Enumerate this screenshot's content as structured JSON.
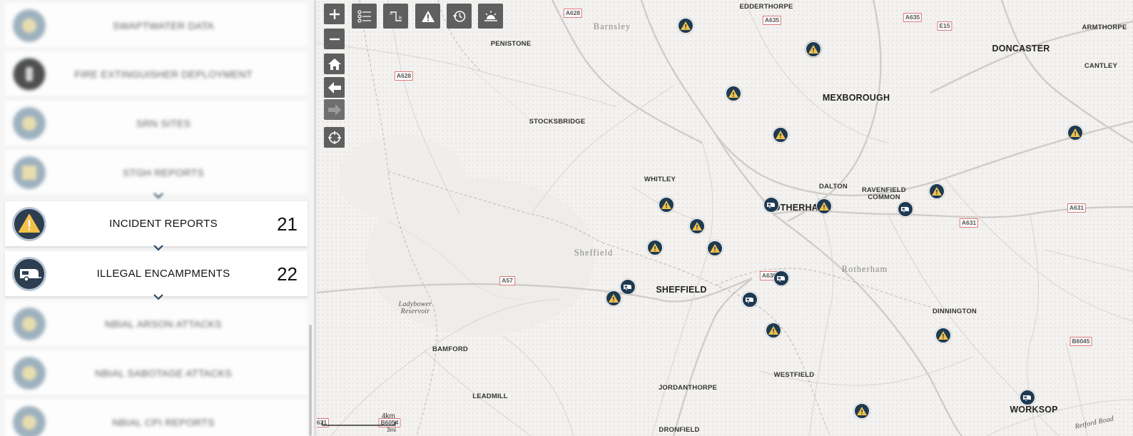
{
  "sidebar": {
    "layers": [
      {
        "label": "SWAPTWATER DATA",
        "blurred": true
      },
      {
        "label": "FIRE EXTINGUISHER DEPLOYMENT",
        "blurred": true
      },
      {
        "label": "SRN SITES",
        "blurred": true
      },
      {
        "label": "STGH REPORTS",
        "blurred": true
      },
      {
        "label": "INCIDENT REPORTS",
        "count": "21",
        "icon": "warning-icon",
        "blurred": false
      },
      {
        "label": "ILLEGAL ENCAMPMENTS",
        "count": "22",
        "icon": "caravan-icon",
        "blurred": false
      },
      {
        "label": "NBIAL ARSON ATTACKS",
        "blurred": true
      },
      {
        "label": "NBIAL SABOTAGE ATTACKS",
        "blurred": true
      },
      {
        "label": "NBIAL CPI REPORTS",
        "blurred": true
      }
    ]
  },
  "toolbar": {
    "vertical": [
      "zoom-in",
      "zoom-out",
      "home",
      "back",
      "forward",
      "locate"
    ],
    "horizontal": [
      "layers-list",
      "measure",
      "incident-filter",
      "history",
      "basemap"
    ]
  },
  "map": {
    "places": [
      {
        "name": "EDDERTHORPE",
        "cls": "small"
      },
      {
        "name": "Barnsley",
        "cls": "region"
      },
      {
        "name": "PENISTONE",
        "cls": "small"
      },
      {
        "name": "ARMTHORPE",
        "cls": "small"
      },
      {
        "name": "DONCASTER",
        "cls": "large"
      },
      {
        "name": "CANTLEY",
        "cls": "small"
      },
      {
        "name": "MEXBOROUGH",
        "cls": "large"
      },
      {
        "name": "STOCKSBRIDGE",
        "cls": "small"
      },
      {
        "name": "WHITLEY",
        "cls": "small"
      },
      {
        "name": "DALTON",
        "cls": "small"
      },
      {
        "name": "RAVENFIELD\nCOMMON",
        "cls": "small"
      },
      {
        "name": "ROTHERHAM",
        "cls": "large"
      },
      {
        "name": "Sheffield",
        "cls": "region"
      },
      {
        "name": "Rotherham",
        "cls": "region"
      },
      {
        "name": "SHEFFIELD",
        "cls": "large"
      },
      {
        "name": "Ladybower\nReservoir",
        "cls": "water"
      },
      {
        "name": "DINNINGTON",
        "cls": "small"
      },
      {
        "name": "BAMFORD",
        "cls": "small"
      },
      {
        "name": "WESTFIELD",
        "cls": "small"
      },
      {
        "name": "JORDANTHORPE",
        "cls": "small"
      },
      {
        "name": "LEADMILL",
        "cls": "small"
      },
      {
        "name": "WORKSOP",
        "cls": "large"
      },
      {
        "name": "DRONFIELD",
        "cls": "small"
      },
      {
        "name": "Retford Road",
        "cls": "water"
      }
    ],
    "roads": [
      "A628",
      "A635",
      "A635",
      "E15",
      "A628",
      "A631",
      "A631",
      "A57",
      "A630",
      "B6045",
      "A621",
      "B6054"
    ],
    "scale_label": "4km",
    "scale_sub": "3mi",
    "incident_markers": 16,
    "encampment_markers": 6
  }
}
